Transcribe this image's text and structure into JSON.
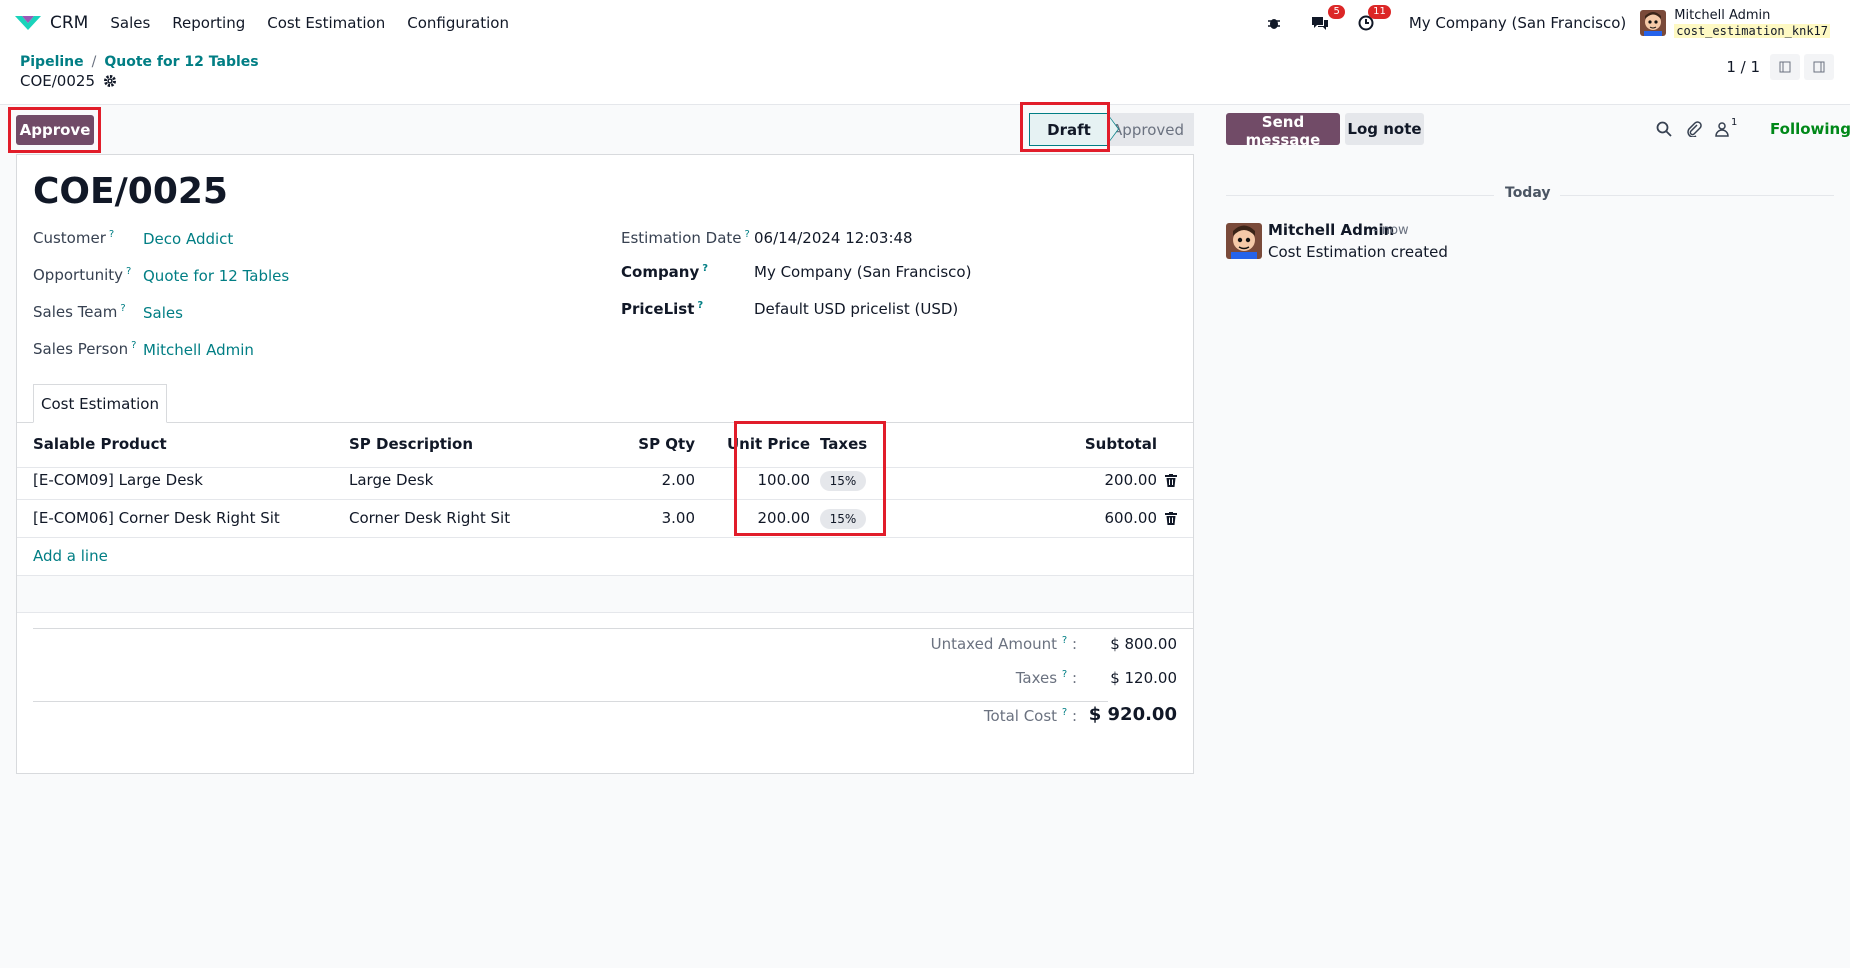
{
  "topbar": {
    "app_name": "CRM",
    "menu": [
      "Sales",
      "Reporting",
      "Cost Estimation",
      "Configuration"
    ],
    "messages_badge": "5",
    "activities_badge": "11",
    "company": "My Company (San Francisco)",
    "user_name": "Mitchell Admin",
    "db_name": "cost_estimation_knk17"
  },
  "breadcrumb": {
    "parent": "Pipeline",
    "sep": "/",
    "current": "Quote for 12 Tables",
    "record": "COE/0025"
  },
  "pager": {
    "text": "1 / 1"
  },
  "actions": {
    "approve": "Approve"
  },
  "status": {
    "draft": "Draft",
    "approved": "Approved",
    "current": "Draft"
  },
  "form": {
    "title": "COE/0025",
    "help_mark": "?",
    "left": [
      {
        "label": "Customer",
        "value": "Deco Addict"
      },
      {
        "label": "Opportunity",
        "value": "Quote for 12 Tables"
      },
      {
        "label": "Sales Team",
        "value": "Sales"
      },
      {
        "label": "Sales Person",
        "value": "Mitchell Admin"
      }
    ],
    "right": [
      {
        "label": "Estimation Date",
        "value": "06/14/2024 12:03:48"
      },
      {
        "label": "Company",
        "value": "My Company (San Francisco)"
      },
      {
        "label": "PriceList",
        "value": "Default USD pricelist (USD)"
      }
    ]
  },
  "tab": {
    "label": "Cost Estimation"
  },
  "lines": {
    "columns": [
      "Salable Product",
      "SP Description",
      "SP Qty",
      "Unit Price",
      "Taxes",
      "Subtotal"
    ],
    "rows": [
      {
        "product": "[E-COM09] Large Desk",
        "description": "Large Desk",
        "qty": "2.00",
        "unit_price": "100.00",
        "tax": "15%",
        "subtotal": "200.00"
      },
      {
        "product": "[E-COM06] Corner Desk Right Sit",
        "description": "Corner Desk Right Sit",
        "qty": "3.00",
        "unit_price": "200.00",
        "tax": "15%",
        "subtotal": "600.00"
      }
    ],
    "add_line": "Add a line"
  },
  "totals": {
    "untaxed_label": "Untaxed Amount",
    "untaxed": "$ 800.00",
    "taxes_label": "Taxes",
    "taxes": "$ 120.00",
    "total_label": "Total Cost",
    "total": "$ 920.00",
    "colon": ":"
  },
  "chatter": {
    "send_message": "Send message",
    "log_note": "Log note",
    "follower_count": "1",
    "following": "Following",
    "date_separator": "Today",
    "message": {
      "author": "Mitchell Admin",
      "time": "- now",
      "body": "Cost Estimation created"
    }
  },
  "colors": {
    "brand": "#714b67",
    "link": "#017e84",
    "highlight": "#e11d2a",
    "following": "#008818"
  }
}
